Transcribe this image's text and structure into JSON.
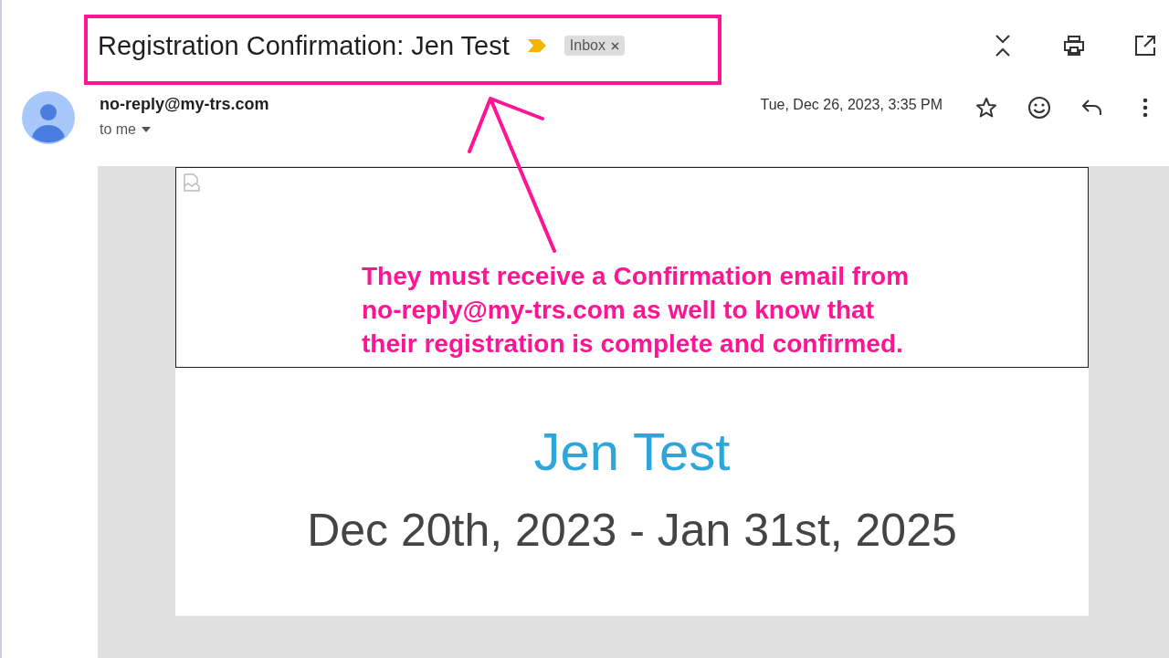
{
  "subject": "Registration Confirmation: Jen Test",
  "labels": [
    {
      "text": "Inbox",
      "removable": true
    }
  ],
  "important": true,
  "sender": {
    "email": "no-reply@my-trs.com",
    "recipient": "to me"
  },
  "date": "Tue, Dec 26, 2023, 3:35 PM",
  "starred": false,
  "body": {
    "name": "Jen Test",
    "dates": "Dec 20th, 2023 - Jan 31st, 2025"
  },
  "annotation": {
    "lines": [
      "They must receive a Confirmation email from",
      "no-reply@my-trs.com as well to know that",
      "their registration is complete and confirmed."
    ]
  }
}
